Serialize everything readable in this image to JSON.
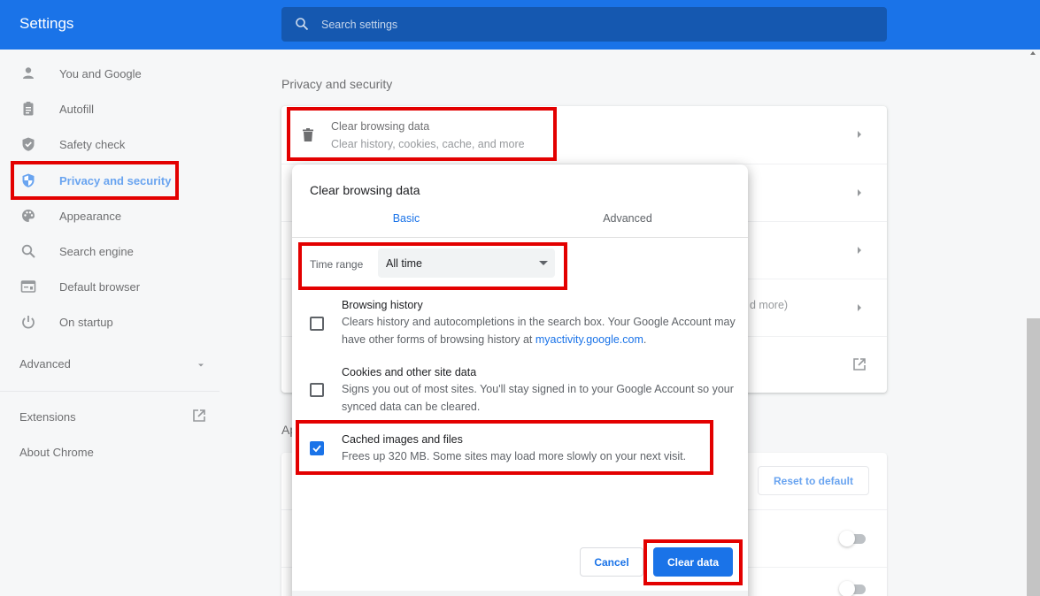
{
  "header": {
    "title": "Settings",
    "search_placeholder": "Search settings"
  },
  "sidebar": {
    "items": [
      {
        "label": "You and Google",
        "icon": "person-icon"
      },
      {
        "label": "Autofill",
        "icon": "clipboard-icon"
      },
      {
        "label": "Safety check",
        "icon": "shield-check-icon"
      },
      {
        "label": "Privacy and security",
        "icon": "shield-icon",
        "active": true
      },
      {
        "label": "Appearance",
        "icon": "palette-icon"
      },
      {
        "label": "Search engine",
        "icon": "search-icon"
      },
      {
        "label": "Default browser",
        "icon": "browser-icon"
      },
      {
        "label": "On startup",
        "icon": "power-icon"
      }
    ],
    "advanced_label": "Advanced",
    "extensions_label": "Extensions",
    "about_label": "About Chrome"
  },
  "main": {
    "section_title": "Privacy and security",
    "clear_row": {
      "title": "Clear browsing data",
      "subtitle": "Clear history, cookies, cache, and more"
    },
    "partial_row_text": "d more)",
    "appearance_peek": "Ap",
    "reset_label": "Reset to default"
  },
  "dialog": {
    "title": "Clear browsing data",
    "tabs": {
      "basic": "Basic",
      "advanced": "Advanced"
    },
    "time_range": {
      "label": "Time range",
      "value": "All time"
    },
    "items": [
      {
        "title": "Browsing history",
        "desc_pre": "Clears history and autocompletions in the search box. Your Google Account may have other forms of browsing history at ",
        "link": "myactivity.google.com",
        "desc_post": ".",
        "checked": false
      },
      {
        "title": "Cookies and other site data",
        "desc": "Signs you out of most sites. You'll stay signed in to your Google Account so your synced data can be cleared.",
        "checked": false
      },
      {
        "title": "Cached images and files",
        "desc": "Frees up 320 MB. Some sites may load more slowly on your next visit.",
        "checked": true
      }
    ],
    "cancel_label": "Cancel",
    "clear_label": "Clear data"
  },
  "colors": {
    "accent": "#1a73e8",
    "highlight": "#e30000"
  }
}
